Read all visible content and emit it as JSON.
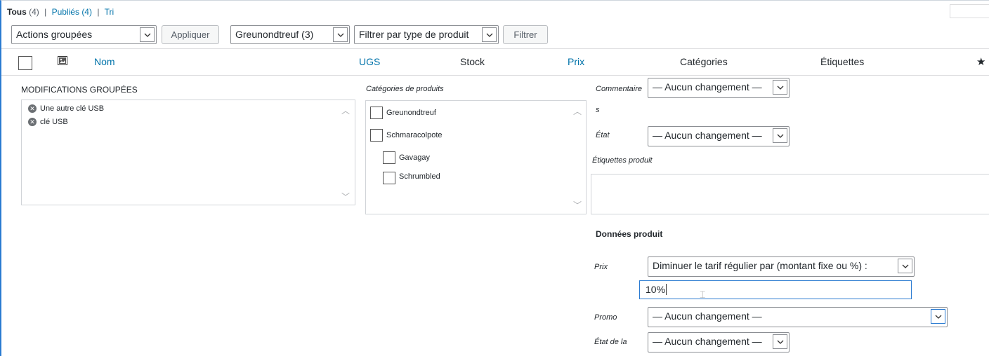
{
  "filters": {
    "all_label": "Tous",
    "all_count": "(4)",
    "sep1": "|",
    "published_label": "Publiés",
    "published_count": "(4)",
    "sep2": "|",
    "sort_label": "Tri"
  },
  "toolbar": {
    "bulk_actions": "Actions groupées",
    "apply": "Appliquer",
    "category_filter": "Greunondtreuf (3)",
    "type_filter": "Filtrer par type de produit",
    "filter": "Filtrer"
  },
  "columns": {
    "name": "Nom",
    "sku": "UGS",
    "stock": "Stock",
    "price": "Prix",
    "categories": "Catégories",
    "tags": "Étiquettes"
  },
  "bulk_edit": {
    "title": "MODIFICATIONS GROUPÉES",
    "items": [
      "Une autre clé USB",
      "clé USB"
    ],
    "categories_label": "Catégories de produits",
    "categories": [
      {
        "label": "Greunondtreuf",
        "level": 0
      },
      {
        "label": "Schmaracolpote",
        "level": 0
      },
      {
        "label": "Gavagay",
        "level": 1
      },
      {
        "label": "Schrumbled",
        "level": 1
      }
    ],
    "comments_label": "Commentaire",
    "comments_label_wrap": "s",
    "comments_value": "— Aucun changement —",
    "status_label": "État",
    "status_value": "— Aucun changement —",
    "tags_label": "Étiquettes produit",
    "product_data_title": "Données produit",
    "price_label": "Prix",
    "price_value": "Diminuer le tarif régulier par (montant fixe ou %) :",
    "price_input": "10%",
    "sale_label": "Promo",
    "sale_value": "— Aucun changement —",
    "tax_label": "État de la",
    "tax_value": "— Aucun changement —"
  }
}
